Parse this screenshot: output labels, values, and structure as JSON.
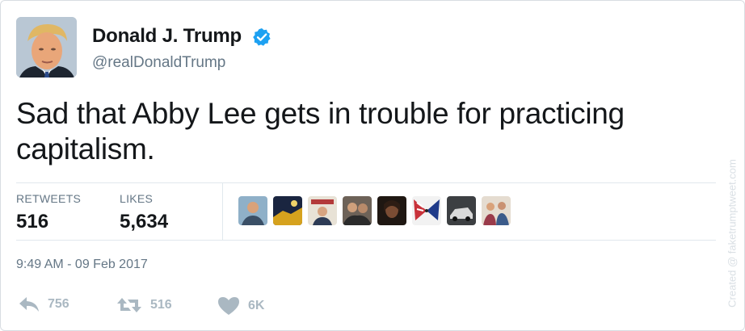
{
  "tweet": {
    "display_name": "Donald J. Trump",
    "handle": "@realDonaldTrump",
    "verified_icon": "verified-badge",
    "text": "Sad that Abby Lee gets in trouble for practicing capitalism.",
    "timestamp": "9:49 AM - 09 Feb 2017"
  },
  "stats": {
    "retweets_label": "RETWEETS",
    "retweets_value": "516",
    "likes_label": "LIKES",
    "likes_value": "5,634"
  },
  "actions": {
    "reply_count": "756",
    "retweet_count": "516",
    "like_count": "6K"
  },
  "watermark": "Created @ faketrumptweet.com",
  "colors": {
    "text": "#14171a",
    "secondary": "#657786",
    "verified": "#1da1f2",
    "action_gray": "#aab8c2",
    "border": "#e1e8ed"
  }
}
